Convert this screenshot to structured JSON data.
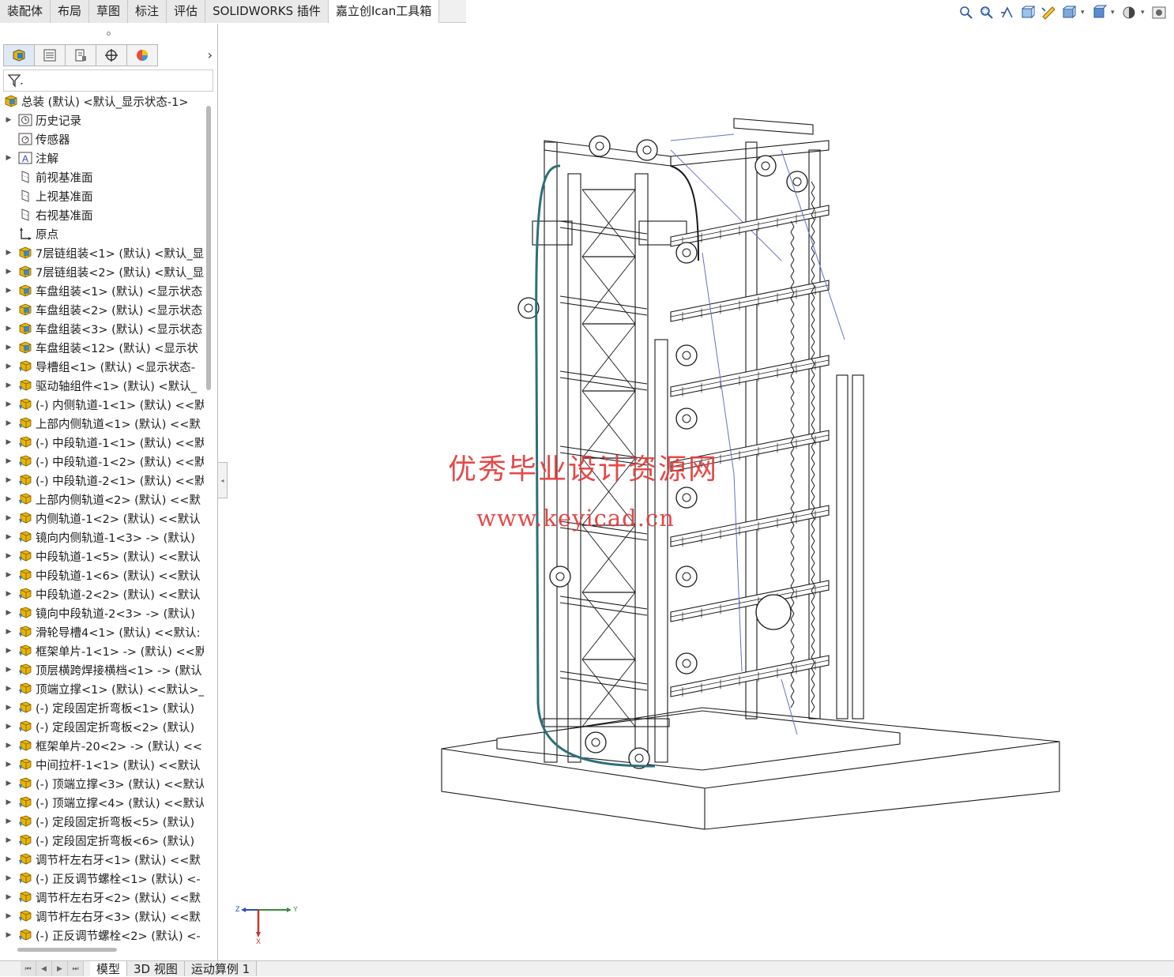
{
  "command_tabs": [
    "装配体",
    "布局",
    "草图",
    "标注",
    "评估",
    "SOLIDWORKS 插件",
    "嘉立创Ican工具箱"
  ],
  "active_command_tab": 6,
  "hud_icons": [
    "zoom-to-fit-icon",
    "zoom-to-area-icon",
    "previous-view-icon",
    "section-view-icon",
    "dynamic-annotation-icon",
    "display-style-icon",
    "hide-show-icon",
    "appearance-icon",
    "scene-icon"
  ],
  "manager_tabs": [
    "featuremanager-icon",
    "propertymanager-icon",
    "configurationmanager-icon",
    "dimxpert-icon",
    "displaymanager-icon"
  ],
  "tree": {
    "root": "总装 (默认) <默认_显示状态-1>",
    "items": [
      {
        "label": "历史记录",
        "icon": "history-icon",
        "expand": true
      },
      {
        "label": "传感器",
        "icon": "sensor-icon",
        "expand": false
      },
      {
        "label": "注解",
        "icon": "annotation-icon",
        "expand": true
      },
      {
        "label": "前视基准面",
        "icon": "plane-icon",
        "expand": false
      },
      {
        "label": "上视基准面",
        "icon": "plane-icon",
        "expand": false
      },
      {
        "label": "右视基准面",
        "icon": "plane-icon",
        "expand": false
      },
      {
        "label": "原点",
        "icon": "origin-icon",
        "expand": false
      },
      {
        "label": "7层链组装<1> (默认) <默认_显",
        "icon": "subassembly-icon",
        "expand": true
      },
      {
        "label": "7层链组装<2> (默认) <默认_显",
        "icon": "subassembly-icon",
        "expand": true
      },
      {
        "label": "车盘组装<1> (默认) <显示状态",
        "icon": "subassembly-icon",
        "expand": true
      },
      {
        "label": "车盘组装<2> (默认) <显示状态",
        "icon": "subassembly-icon",
        "expand": true
      },
      {
        "label": "车盘组装<3> (默认) <显示状态",
        "icon": "subassembly-icon",
        "expand": true
      },
      {
        "label": "车盘组装<12> (默认) <显示状",
        "icon": "subassembly-icon",
        "expand": true
      },
      {
        "label": "导槽组<1> (默认) <显示状态-",
        "icon": "part-icon",
        "expand": true
      },
      {
        "label": "驱动轴组件<1> (默认) <默认_",
        "icon": "part-icon",
        "expand": true
      },
      {
        "label": "(-) 内侧轨道-1<1> (默认) <<默",
        "icon": "part-icon",
        "expand": true
      },
      {
        "label": "上部内侧轨道<1> (默认) <<默",
        "icon": "part-icon",
        "expand": true
      },
      {
        "label": "(-) 中段轨道-1<1> (默认) <<默",
        "icon": "part-icon",
        "expand": true
      },
      {
        "label": "(-) 中段轨道-1<2> (默认) <<默",
        "icon": "part-icon",
        "expand": true
      },
      {
        "label": "(-) 中段轨道-2<1> (默认) <<默",
        "icon": "part-icon",
        "expand": true
      },
      {
        "label": "上部内侧轨道<2> (默认) <<默",
        "icon": "part-icon",
        "expand": true
      },
      {
        "label": "内侧轨道-1<2> (默认) <<默认",
        "icon": "part-icon",
        "expand": true
      },
      {
        "label": "镜向内侧轨道-1<3> -> (默认)",
        "icon": "part-icon",
        "expand": true
      },
      {
        "label": "中段轨道-1<5> (默认) <<默认",
        "icon": "part-icon",
        "expand": true
      },
      {
        "label": "中段轨道-1<6> (默认) <<默认",
        "icon": "part-icon",
        "expand": true
      },
      {
        "label": "中段轨道-2<2> (默认) <<默认",
        "icon": "part-icon",
        "expand": true
      },
      {
        "label": "镜向中段轨道-2<3> -> (默认)",
        "icon": "part-icon",
        "expand": true
      },
      {
        "label": "滑轮导槽4<1> (默认) <<默认:",
        "icon": "part-icon",
        "expand": true
      },
      {
        "label": "框架单片-1<1> -> (默认) <<默",
        "icon": "part-icon",
        "expand": true
      },
      {
        "label": "顶层横跨焊接横档<1> -> (默认",
        "icon": "part-icon",
        "expand": true
      },
      {
        "label": "顶端立撑<1> (默认) <<默认>_",
        "icon": "part-icon",
        "expand": true
      },
      {
        "label": "(-) 定段固定折弯板<1> (默认)",
        "icon": "part-icon",
        "expand": true
      },
      {
        "label": "(-) 定段固定折弯板<2> (默认)",
        "icon": "part-icon",
        "expand": true
      },
      {
        "label": "框架单片-20<2> -> (默认) <<",
        "icon": "part-icon",
        "expand": true
      },
      {
        "label": "中间拉杆-1<1> (默认) <<默认",
        "icon": "part-icon",
        "expand": true
      },
      {
        "label": "(-) 顶端立撑<3> (默认) <<默认",
        "icon": "part-icon",
        "expand": true
      },
      {
        "label": "(-) 顶端立撑<4> (默认) <<默认",
        "icon": "part-icon",
        "expand": true
      },
      {
        "label": "(-) 定段固定折弯板<5> (默认)",
        "icon": "part-icon",
        "expand": true
      },
      {
        "label": "(-) 定段固定折弯板<6> (默认)",
        "icon": "part-icon",
        "expand": true
      },
      {
        "label": "调节杆左右牙<1> (默认) <<默",
        "icon": "part-icon",
        "expand": true
      },
      {
        "label": "(-) 正反调节螺栓<1> (默认) <-",
        "icon": "part-icon",
        "expand": true
      },
      {
        "label": "调节杆左右牙<2> (默认) <<默",
        "icon": "part-icon",
        "expand": true
      },
      {
        "label": "调节杆左右牙<3> (默认) <<默",
        "icon": "part-icon",
        "expand": true
      },
      {
        "label": "(-) 正反调节螺栓<2> (默认) <-",
        "icon": "part-icon",
        "expand": true
      }
    ]
  },
  "watermark": {
    "line1": "优秀毕业设计资源网",
    "line2": "www.keyicad.cn",
    "color": "#e23a3a"
  },
  "triad": {
    "x_label": "X",
    "y_label": "Y",
    "z_label": "Z"
  },
  "bottom_tabs": [
    "模型",
    "3D 视图",
    "运动算例 1"
  ],
  "active_bottom_tab": 0,
  "colors": {
    "tree_part": "#e9b400",
    "tree_asm": "#2f7fc9",
    "watermark": "#e23a3a"
  }
}
